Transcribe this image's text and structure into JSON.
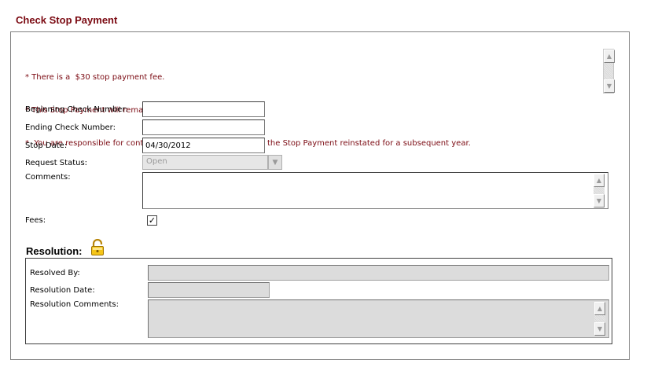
{
  "page": {
    "title": "Check Stop Payment"
  },
  "notices": [
    "* There is a  $30 stop payment fee.",
    "* This Stop Payment will remain in effect for one year.",
    "*  You are responsible for contacting the credit union to have the Stop Payment reinstated for a subsequent year."
  ],
  "form": {
    "beginning_check_label": "Beginning Check Number:",
    "beginning_check_value": "",
    "ending_check_label": "Ending Check Number:",
    "ending_check_value": "",
    "stop_date_label": "Stop Date:",
    "stop_date_value": "04/30/2012",
    "request_status_label": "Request Status:",
    "request_status_value": "Open",
    "comments_label": "Comments:",
    "fees_label": "Fees:",
    "fees_checked": true
  },
  "resolution": {
    "title": "Resolution:",
    "resolved_by_label": "Resolved By:",
    "resolution_date_label": "Resolution Date:",
    "resolution_comments_label": "Resolution Comments:"
  },
  "colors": {
    "title": "#7b0a12",
    "notice": "#7b0a12",
    "readonly_bg": "#dcdcdc"
  },
  "icons": {
    "lock": "lock-icon",
    "scroll_up": "scroll-up-icon",
    "scroll_down": "scroll-down-icon",
    "dropdown": "chevron-down-icon",
    "check": "checkmark-icon"
  }
}
